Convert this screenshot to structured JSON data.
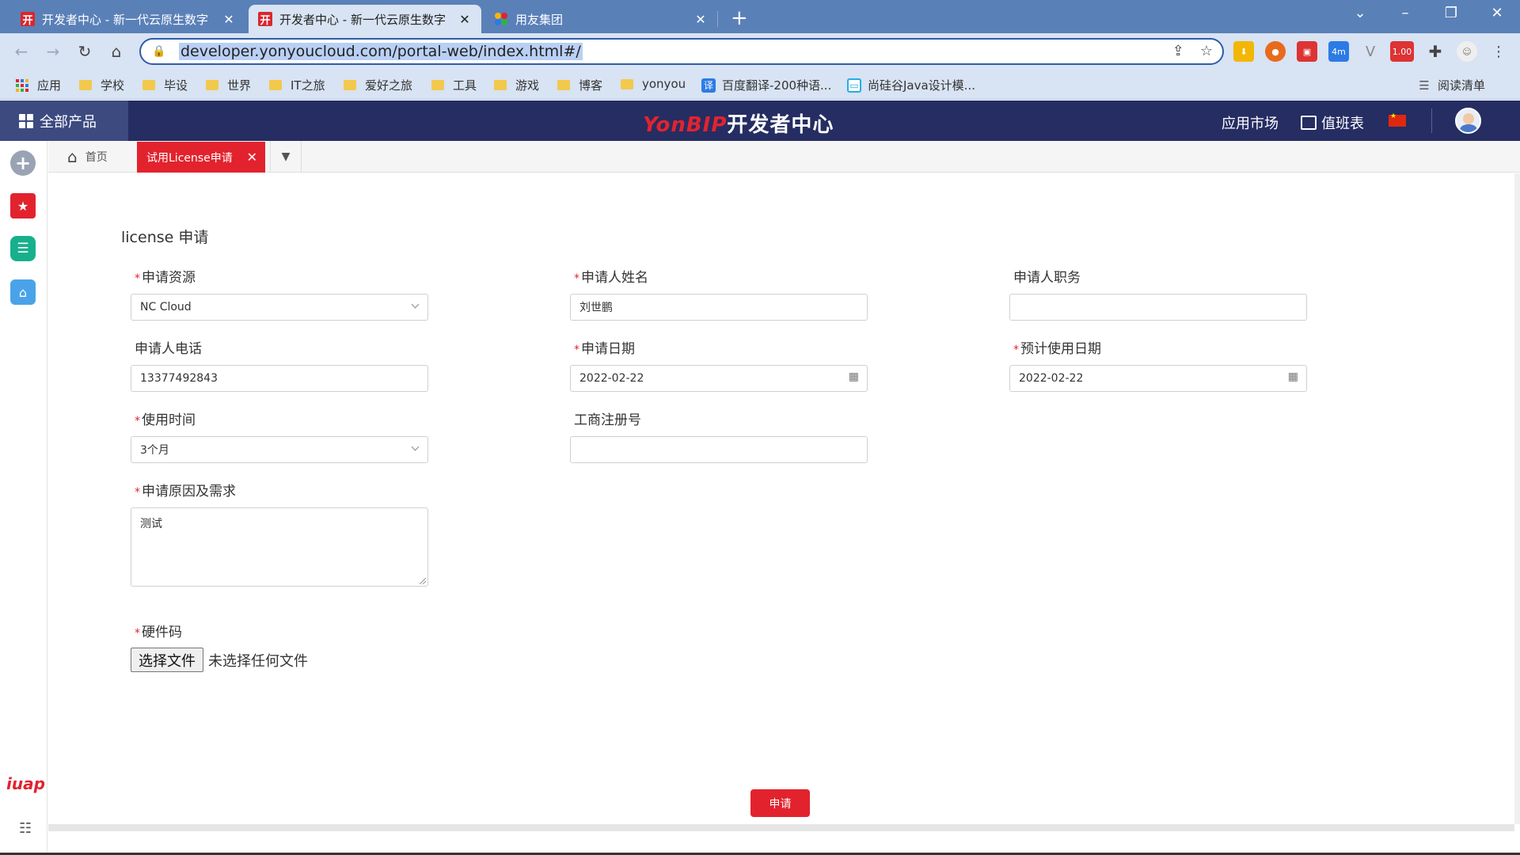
{
  "browser": {
    "tabs": [
      {
        "title": "开发者中心 - 新一代云原生数字",
        "favicon": "开",
        "active": false
      },
      {
        "title": "开发者中心 - 新一代云原生数字",
        "favicon": "开",
        "active": true
      },
      {
        "title": "用友集团",
        "favicon": "",
        "active": false
      }
    ],
    "url": "developer.yonyoucloud.com/portal-web/index.html#/",
    "extensions": {
      "badge_4m": "4m",
      "badge_100": "1.00"
    },
    "bookmarks": [
      {
        "label": "应用",
        "type": "apps"
      },
      {
        "label": "学校",
        "type": "folder"
      },
      {
        "label": "毕设",
        "type": "folder"
      },
      {
        "label": "世界",
        "type": "folder"
      },
      {
        "label": "IT之旅",
        "type": "folder"
      },
      {
        "label": "爱好之旅",
        "type": "folder"
      },
      {
        "label": "工具",
        "type": "folder"
      },
      {
        "label": "游戏",
        "type": "folder"
      },
      {
        "label": "博客",
        "type": "folder"
      },
      {
        "label": "yonyou",
        "type": "folder"
      },
      {
        "label": "百度翻译-200种语...",
        "type": "translate"
      },
      {
        "label": "尚硅谷Java设计模...",
        "type": "bilibili"
      }
    ],
    "reading_list": "阅读清单"
  },
  "header": {
    "all_products": "全部产品",
    "brand_yon": "YonBIP",
    "brand_dev": "开发者中心",
    "app_market": "应用市场",
    "duty_table": "值班表"
  },
  "rail": {
    "logo": "iuap"
  },
  "pagetabs": {
    "home": "首页",
    "active": "试用License申请"
  },
  "form": {
    "title": "license 申请",
    "fields": {
      "resource": {
        "label": "申请资源",
        "required": true,
        "value": "NC Cloud"
      },
      "name": {
        "label": "申请人姓名",
        "required": true,
        "value": "刘世鹏"
      },
      "position": {
        "label": "申请人职务",
        "required": false,
        "value": ""
      },
      "phone": {
        "label": "申请人电话",
        "required": false,
        "value": "13377492843"
      },
      "apply_date": {
        "label": "申请日期",
        "required": true,
        "value": "2022-02-22"
      },
      "expected_date": {
        "label": "预计使用日期",
        "required": true,
        "value": "2022-02-22"
      },
      "duration": {
        "label": "使用时间",
        "required": true,
        "value": "3个月"
      },
      "reg_no": {
        "label": "工商注册号",
        "required": false,
        "value": ""
      },
      "reason": {
        "label": "申请原因及需求",
        "required": true,
        "value": "测试"
      },
      "hardware": {
        "label": "硬件码",
        "required": true
      }
    },
    "file_button": "选择文件",
    "file_status": "未选择任何文件",
    "submit": "申请"
  },
  "colors": {
    "brand_red": "#e2232e",
    "header_navy": "#252d62",
    "chrome_blue": "#5a80b8"
  }
}
